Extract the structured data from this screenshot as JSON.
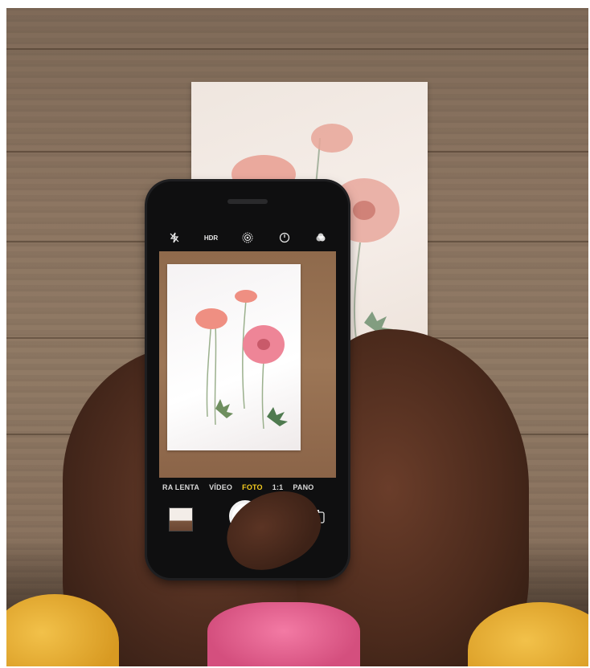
{
  "scene": {
    "colors": {
      "wood": "#8d7662",
      "card": "#f6eee9",
      "sleeve": "#e5a92c",
      "shirt": "#e8628f",
      "phone": "#0f0f10",
      "active_mode": "#f5cc1f"
    }
  },
  "phone": {
    "top_icons": [
      {
        "icon": "flash-off-icon",
        "glyph": "⚡︎̸"
      },
      {
        "icon": "hdr-icon",
        "glyph": "HDR"
      },
      {
        "icon": "live-photo-icon",
        "glyph": "◎"
      },
      {
        "icon": "timer-icon",
        "glyph": "◷"
      },
      {
        "icon": "filters-icon",
        "glyph": "●"
      }
    ],
    "modes": [
      "RA LENTA",
      "VÍDEO",
      "FOTO",
      "1:1",
      "PANO"
    ],
    "active_mode": "FOTO",
    "flip_icon_glyph": "↻"
  }
}
